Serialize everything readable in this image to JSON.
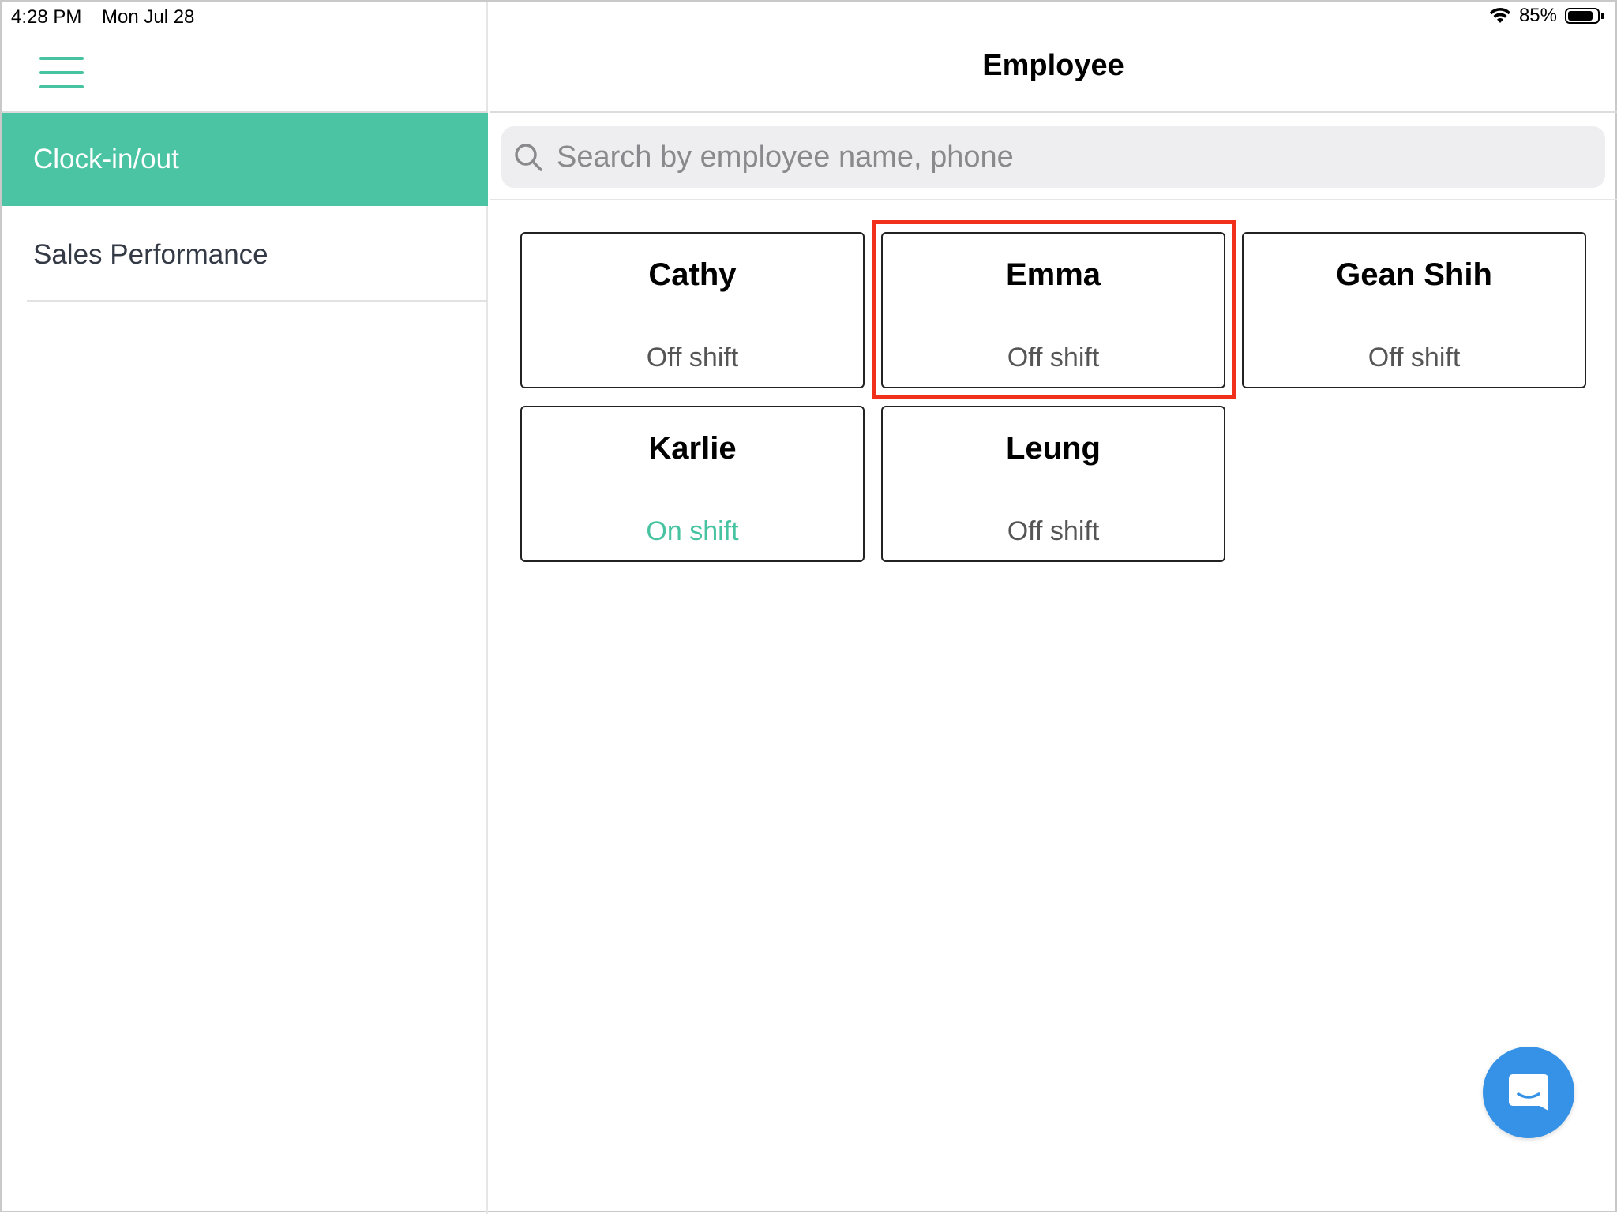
{
  "status_bar": {
    "time": "4:28 PM",
    "date": "Mon Jul 28",
    "battery": "85%",
    "battery_level": 0.85
  },
  "sidebar": {
    "menu_icon": "hamburger-menu-icon",
    "items": [
      {
        "label": "Clock-in/out",
        "active": true
      },
      {
        "label": "Sales Performance",
        "active": false
      }
    ]
  },
  "header": {
    "title": "Employee"
  },
  "search": {
    "placeholder": "Search by employee name, phone",
    "value": "",
    "icon": "search-icon"
  },
  "employees": [
    {
      "name": "Cathy",
      "status": "Off shift"
    },
    {
      "name": "Emma",
      "status": "Off shift",
      "highlighted": true
    },
    {
      "name": "Gean Shih",
      "status": "Off shift"
    },
    {
      "name": "Karlie",
      "status": "On shift"
    },
    {
      "name": "Leung",
      "status": "Off shift"
    }
  ],
  "chat_button": {
    "icon": "chat-icon"
  },
  "colors": {
    "accent": "#4ac4a3",
    "on_shift": "#47c3a1",
    "highlight": "#f0301a",
    "chat_fab": "#3592e6"
  }
}
